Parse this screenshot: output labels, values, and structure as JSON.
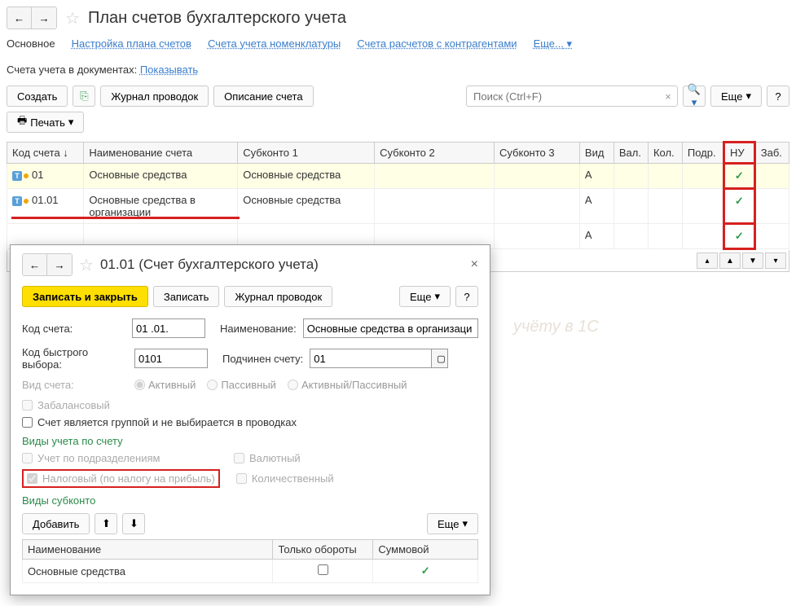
{
  "header": {
    "title": "План счетов бухгалтерского учета"
  },
  "tabs": {
    "main": "Основное",
    "setup": "Настройка плана счетов",
    "nomenclature": "Счета учета номенклатуры",
    "contractors": "Счета расчетов с контрагентами",
    "more": "Еще..."
  },
  "filter": {
    "label": "Счета учета в документах:",
    "link": "Показывать"
  },
  "toolbar": {
    "create": "Создать",
    "journal": "Журнал проводок",
    "desc": "Описание счета",
    "search_placeholder": "Поиск (Ctrl+F)",
    "more": "Еще",
    "print": "Печать"
  },
  "grid": {
    "cols": {
      "code": "Код счета",
      "name": "Наименование счета",
      "sub1": "Субконто 1",
      "sub2": "Субконто 2",
      "sub3": "Субконто 3",
      "vid": "Вид",
      "val": "Вал.",
      "kol": "Кол.",
      "podr": "Подр.",
      "nu": "НУ",
      "zab": "Заб."
    },
    "rows": [
      {
        "code": "01",
        "name": "Основные средства",
        "sub1": "Основные средства",
        "vid": "А",
        "nu": true,
        "hl": true,
        "dot": true
      },
      {
        "code": "01.01",
        "name": "Основные средства в организации",
        "sub1": "Основные средства",
        "vid": "А",
        "nu": true,
        "hl": false,
        "dot": true
      },
      {
        "code": "",
        "name": "",
        "sub1": "",
        "vid": "А",
        "nu": true,
        "hl": false,
        "dot": false
      }
    ]
  },
  "dialog": {
    "title": "01.01 (Счет бухгалтерского учета)",
    "save_close": "Записать и закрыть",
    "save": "Записать",
    "journal": "Журнал проводок",
    "more": "Еще",
    "form": {
      "code_label": "Код счета:",
      "code_value": "01 .01.",
      "name_label": "Наименование:",
      "name_value": "Основные средства в организаци",
      "quick_label": "Код быстрого выбора:",
      "quick_value": "0101",
      "parent_label": "Подчинен счету:",
      "parent_value": "01",
      "type_label": "Вид счета:",
      "active": "Активный",
      "passive": "Пассивный",
      "activepassive": "Активный/Пассивный",
      "offbalance": "Забалансовый",
      "group": "Счет является группой и не выбирается в проводках"
    },
    "section1": "Виды учета по счету",
    "cb": {
      "podr": "Учет по подразделениям",
      "val": "Валютный",
      "tax": "Налоговый (по налогу на прибыль)",
      "qty": "Количественный"
    },
    "section2": "Виды субконто",
    "sub_toolbar": {
      "add": "Добавить",
      "more": "Еще"
    },
    "sub_cols": {
      "name": "Наименование",
      "turnover": "Только обороты",
      "sum": "Суммовой"
    },
    "sub_rows": [
      {
        "name": "Основные средства",
        "turnover": false,
        "sum": true
      }
    ]
  }
}
